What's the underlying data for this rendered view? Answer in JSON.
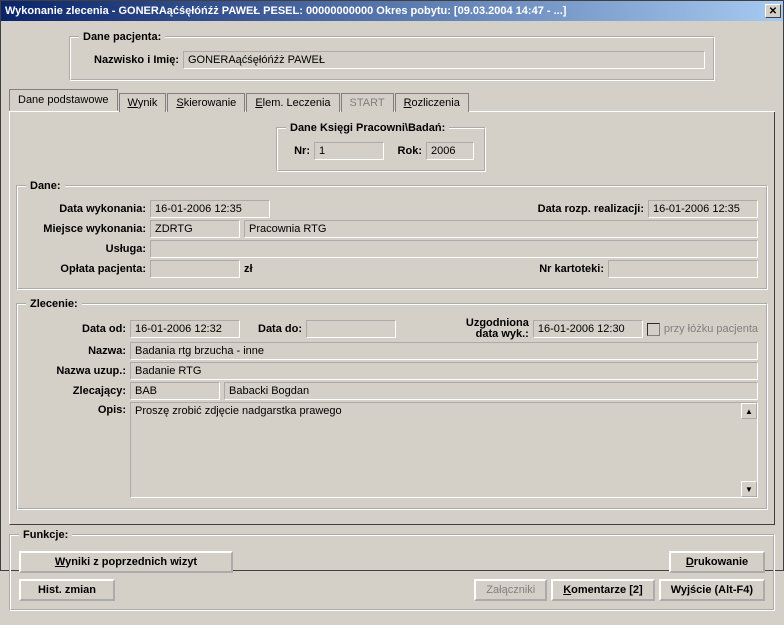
{
  "titlebar": "Wykonanie zlecenia -  GONERAąćśęłóńźż PAWEŁ PESEL: 00000000000 Okres pobytu: [09.03.2004 14:47 - ...]",
  "patient": {
    "legend": "Dane pacjenta:",
    "name_label": "Nazwisko i Imię:",
    "name_value": "GONERAąćśęłóńźż PAWEŁ"
  },
  "tabs": {
    "podstawowe": "Dane podstawowe",
    "wynik": "Wynik",
    "skierowanie": "Skierowanie",
    "elem": "Elem. Leczenia",
    "start": "START",
    "rozlicz": "Rozliczenia"
  },
  "ksiega": {
    "legend": "Dane Księgi Pracowni\\Badań:",
    "nr_label": "Nr:",
    "nr_value": "1",
    "rok_label": "Rok:",
    "rok_value": "2006"
  },
  "dane": {
    "legend": "Dane:",
    "data_wyk_label": "Data wykonania:",
    "data_wyk_value": "16-01-2006 12:35",
    "data_rozp_label": "Data rozp. realizacji:",
    "data_rozp_value": "16-01-2006 12:35",
    "miejsce_label": "Miejsce wykonania:",
    "miejsce_code": "ZDRTG",
    "miejsce_name": "Pracownia RTG",
    "usluga_label": "Usługa:",
    "usluga_value": "",
    "oplata_label": "Opłata pacjenta:",
    "oplata_value": "",
    "oplata_unit": "zł",
    "kartoteka_label": "Nr kartoteki:",
    "kartoteka_value": ""
  },
  "zlecenie": {
    "legend": "Zlecenie:",
    "data_od_label": "Data od:",
    "data_od_value": "16-01-2006 12:32",
    "data_do_label": "Data do:",
    "data_do_value": "",
    "uzg_label1": "Uzgodniona",
    "uzg_label2": "data wyk.:",
    "uzg_value": "16-01-2006 12:30",
    "przy_lozku": "przy łóżku pacjenta",
    "nazwa_label": "Nazwa:",
    "nazwa_value": "Badania rtg brzucha - inne",
    "nazwa_uzup_label": "Nazwa uzup.:",
    "nazwa_uzup_value": "Badanie RTG",
    "zlec_label": "Zlecający:",
    "zlec_code": "BAB",
    "zlec_name": "Babacki Bogdan",
    "opis_label": "Opis:",
    "opis_value": "Proszę zrobić zdjęcie nadgarstka prawego"
  },
  "funkcje": {
    "legend": "Funkcje:",
    "wyniki_poprz": "Wyniki z poprzednich wizyt",
    "druk": "Drukowanie",
    "hist": "Hist. zmian",
    "zalaczniki": "Załączniki",
    "komentarze": "Komentarze [2]",
    "wyjscie": "Wyjście (Alt-F4)"
  }
}
